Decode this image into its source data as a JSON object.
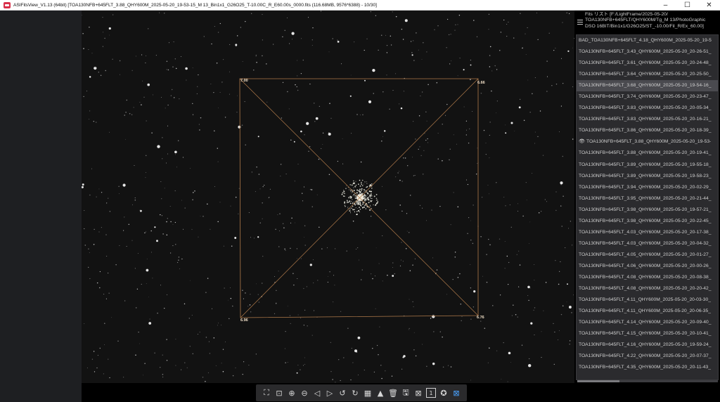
{
  "window": {
    "title": "ASIFitsView_V1.13 (64bit) [TOA130NFB+645FLT_3.88_QHY600M_2025-05-20_19-53-15_M 13_Bin1x1_G26O25_T-10.00C_R_E60.00s_0000.fits (116.68MB, 9576*6388) - 10/30]",
    "controls": {
      "minimize": "–",
      "maximize": "☐",
      "close": "✕"
    }
  },
  "fits_panel": {
    "line1": "Fits リスト [F:/LightFrame/2025-05-20/",
    "line2": "TOA130NFB+645FLT/QHY600M/Tg_M 13/PhotoGraphic",
    "line3": "DSO 16BIT/Bin1x1/G26O25/ST_-10.00/Fil_R/Ex_60.00]"
  },
  "file_list": [
    {
      "name": "BAD_TOA130NFB+645FLT_4.18_QHY600M_2025-05-20_19-5",
      "selected": false,
      "viewing": false
    },
    {
      "name": "TOA130NFB+645FLT_3.43_QHY600M_2025-05-20_20-26-51_",
      "selected": false,
      "viewing": false
    },
    {
      "name": "TOA130NFB+645FLT_3.61_QHY600M_2025-05-20_20-24-48_",
      "selected": false,
      "viewing": false
    },
    {
      "name": "TOA130NFB+645FLT_3.64_QHY600M_2025-05-20_20-25-50_",
      "selected": false,
      "viewing": false
    },
    {
      "name": "TOA130NFB+645FLT_3.68_QHY600M_2025-05-20_19-54-16_",
      "selected": true,
      "viewing": false
    },
    {
      "name": "TOA130NFB+645FLT_3.74_QHY600M_2025-05-20_20-23-47_",
      "selected": false,
      "viewing": false
    },
    {
      "name": "TOA130NFB+645FLT_3.83_QHY600M_2025-05-20_20-05-34_",
      "selected": false,
      "viewing": false
    },
    {
      "name": "TOA130NFB+645FLT_3.83_QHY600M_2025-05-20_20-16-21_",
      "selected": false,
      "viewing": false
    },
    {
      "name": "TOA130NFB+645FLT_3.86_QHY600M_2025-05-20_20-18-39_",
      "selected": false,
      "viewing": false
    },
    {
      "name": "TOA130NFB+645FLT_3.88_QHY600M_2025-05-20_19-53-",
      "selected": false,
      "viewing": true
    },
    {
      "name": "TOA130NFB+645FLT_3.88_QHY600M_2025-05-20_20-19-41_",
      "selected": false,
      "viewing": false
    },
    {
      "name": "TOA130NFB+645FLT_3.89_QHY600M_2025-05-20_19-55-18_",
      "selected": false,
      "viewing": false
    },
    {
      "name": "TOA130NFB+645FLT_3.89_QHY600M_2025-05-20_19-58-23_",
      "selected": false,
      "viewing": false
    },
    {
      "name": "TOA130NFB+645FLT_3.94_QHY600M_2025-05-20_20-02-29_",
      "selected": false,
      "viewing": false
    },
    {
      "name": "TOA130NFB+645FLT_3.95_QHY600M_2025-05-20_20-21-44_",
      "selected": false,
      "viewing": false
    },
    {
      "name": "TOA130NFB+645FLT_3.98_QHY600M_2025-05-20_19-57-21_",
      "selected": false,
      "viewing": false
    },
    {
      "name": "TOA130NFB+645FLT_3.98_QHY600M_2025-05-20_20-22-45_",
      "selected": false,
      "viewing": false
    },
    {
      "name": "TOA130NFB+645FLT_4.03_QHY600M_2025-05-20_20-17-38_",
      "selected": false,
      "viewing": false
    },
    {
      "name": "TOA130NFB+645FLT_4.03_QHY600M_2025-05-20_20-04-32_",
      "selected": false,
      "viewing": false
    },
    {
      "name": "TOA130NFB+645FLT_4.05_QHY600M_2025-05-20_20-01-27_",
      "selected": false,
      "viewing": false
    },
    {
      "name": "TOA130NFB+645FLT_4.06_QHY600M_2025-05-20_20-00-26_",
      "selected": false,
      "viewing": false
    },
    {
      "name": "TOA130NFB+645FLT_4.08_QHY600M_2025-05-20_20-08-38_",
      "selected": false,
      "viewing": false
    },
    {
      "name": "TOA130NFB+645FLT_4.08_QHY600M_2025-05-20_20-20-42_",
      "selected": false,
      "viewing": false
    },
    {
      "name": "TOA130NFB+645FLT_4.11_QHY600M_2025-05-20_20-03-30_",
      "selected": false,
      "viewing": false
    },
    {
      "name": "TOA130NFB+645FLT_4.11_QHY600M_2025-05-20_20-06-35_",
      "selected": false,
      "viewing": false
    },
    {
      "name": "TOA130NFB+645FLT_4.14_QHY600M_2025-05-20_20-09-40_",
      "selected": false,
      "viewing": false
    },
    {
      "name": "TOA130NFB+645FLT_4.15_QHY600M_2025-05-20_20-10-41_",
      "selected": false,
      "viewing": false
    },
    {
      "name": "TOA130NFB+645FLT_4.16_QHY600M_2025-05-20_19-59-24_",
      "selected": false,
      "viewing": false
    },
    {
      "name": "TOA130NFB+645FLT_4.22_QHY600M_2025-05-20_20-07-37_",
      "selected": false,
      "viewing": false
    },
    {
      "name": "TOA130NFB+645FLT_4.35_QHY600M_2025-05-20_20-11-43_",
      "selected": false,
      "viewing": false
    }
  ],
  "tilt_overlay": {
    "top_left": "7.00",
    "top_right": "6.66",
    "bottom_left": "6.96",
    "bottom_right": "6.76"
  },
  "toolbar": [
    {
      "name": "fit-to-window-icon",
      "glyph": "⛶",
      "boxed": false,
      "active": false
    },
    {
      "name": "actual-size-icon",
      "glyph": "⊡",
      "boxed": false,
      "active": false
    },
    {
      "name": "zoom-in-icon",
      "glyph": "⊕",
      "boxed": false,
      "active": false
    },
    {
      "name": "zoom-out-icon",
      "glyph": "⊖",
      "boxed": false,
      "active": false
    },
    {
      "name": "previous-icon",
      "glyph": "◁",
      "boxed": false,
      "active": false
    },
    {
      "name": "next-icon",
      "glyph": "▷",
      "boxed": false,
      "active": false
    },
    {
      "name": "rotate-left-icon",
      "glyph": "↺",
      "boxed": false,
      "active": false
    },
    {
      "name": "rotate-right-icon",
      "glyph": "↻",
      "boxed": false,
      "active": false
    },
    {
      "name": "stretch-icon",
      "glyph": "▦",
      "boxed": false,
      "active": false
    },
    {
      "name": "star-detect-icon",
      "glyph": "▲",
      "boxed": false,
      "active": false
    },
    {
      "name": "delete-icon",
      "glyph": "🗑",
      "boxed": false,
      "active": false
    },
    {
      "name": "save-icon",
      "glyph": "🖫",
      "boxed": false,
      "active": false
    },
    {
      "name": "compare-icon",
      "glyph": "⊠",
      "boxed": false,
      "active": false
    },
    {
      "name": "one-to-one-icon",
      "glyph": "1",
      "boxed": true,
      "active": false
    },
    {
      "name": "star-analysis-icon",
      "glyph": "✪",
      "boxed": false,
      "active": false
    },
    {
      "name": "tilt-overlay-icon",
      "glyph": "⊠",
      "boxed": false,
      "active": true
    }
  ]
}
